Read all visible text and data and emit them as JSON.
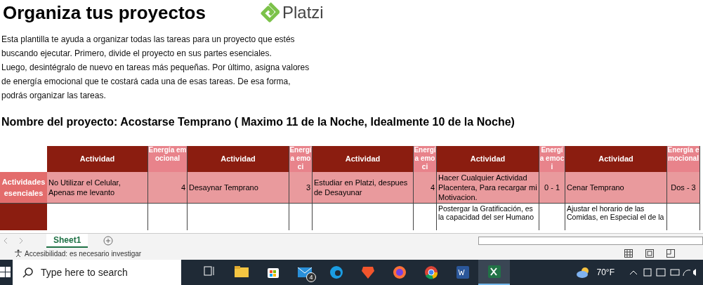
{
  "title": "Organiza tus proyectos",
  "logo": {
    "text": "Platzi"
  },
  "description": [
    "Esta plantilla te ayuda a organizar todas las tareas para un proyecto que estés",
    "buscando ejecutar. Primero, divide el proyecto en sus partes esenciales.",
    "Luego, desintégralo de nuevo en tareas más pequeñas. Por último, asigna valores",
    "de energía emocional que te costará cada una de esas tareas. De esa forma,",
    "podrás organizar las tareas."
  ],
  "project_heading": "Nombre del proyecto:  Acostarse Temprano ( Maximo 11 de la Noche, Idealmente 10 de la Noche)",
  "table": {
    "columns": [
      {
        "kind": "activity",
        "label": "Actividad"
      },
      {
        "kind": "energy",
        "label": "Energía emocional"
      },
      {
        "kind": "activity",
        "label": "Actividad"
      },
      {
        "kind": "energy",
        "label": "Energía emoci"
      },
      {
        "kind": "activity",
        "label": "Actividad"
      },
      {
        "kind": "energy",
        "label": "Energía emoci"
      },
      {
        "kind": "activity",
        "label": "Actividad"
      },
      {
        "kind": "energy",
        "label": "Energía emoci"
      },
      {
        "kind": "activity",
        "label": "Actividad"
      },
      {
        "kind": "energy",
        "label": "Energía emocional"
      }
    ],
    "rows": [
      {
        "kind": "essential",
        "label": "Actividades esenciales",
        "cells": [
          "No Utilizar el Celular, Apenas me levanto",
          "4",
          "Desaynar Temprano",
          "3",
          "Estudiar en Platzi, despues de Desayunar",
          "4",
          "Hacer Cualquier Actividad Placentera, Para recargar mi Motivacion.",
          "0 - 1",
          "Cenar Temprano",
          "Dos - 3"
        ]
      },
      {
        "kind": "task",
        "cells": [
          "",
          "",
          "",
          "",
          "",
          "",
          "Postergar la Gratificación, es la capacidad del ser Humano",
          "",
          "Ajustar el horario de las Comidas, en Especial el de la",
          ""
        ]
      }
    ]
  },
  "sheet_tabs": [
    {
      "label": "Sheet1",
      "selected": true
    }
  ],
  "status_bar": {
    "accessibility": "Accesibilidad: es necesario investigar"
  },
  "taskbar": {
    "search_placeholder": "Type here to search",
    "mail_badge": "4",
    "weather": "70°F",
    "apps": [
      {
        "kind": "task-view",
        "selected": false
      },
      {
        "kind": "files",
        "selected": false
      },
      {
        "kind": "store",
        "selected": false
      },
      {
        "kind": "mail",
        "selected": false
      },
      {
        "kind": "edge",
        "selected": false
      },
      {
        "kind": "brave",
        "selected": false
      },
      {
        "kind": "firefox",
        "selected": false
      },
      {
        "kind": "chrome",
        "selected": false
      },
      {
        "kind": "word",
        "selected": false
      },
      {
        "kind": "excel",
        "selected": true
      }
    ]
  }
}
